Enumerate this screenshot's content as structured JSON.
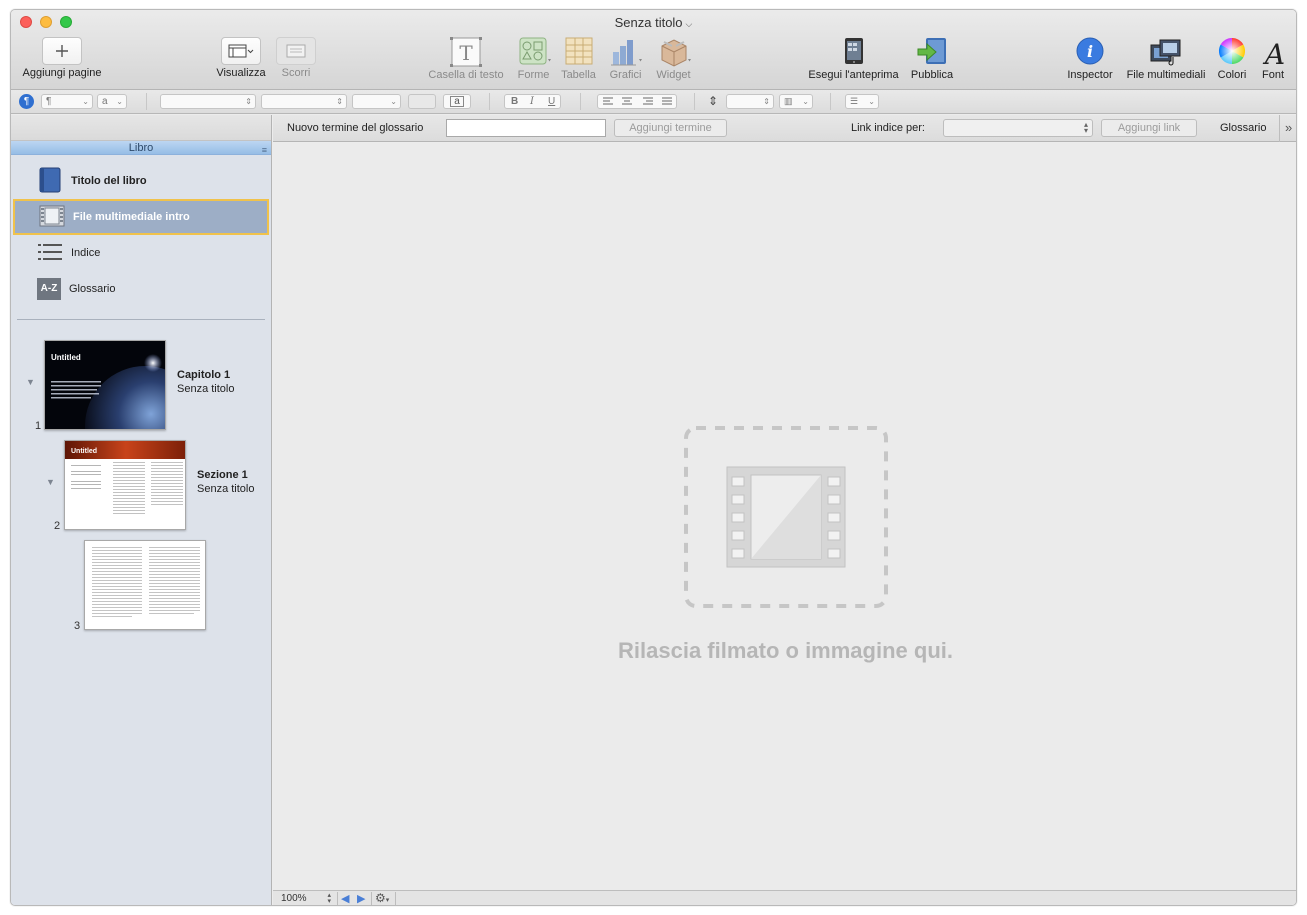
{
  "window": {
    "title": "Senza titolo"
  },
  "toolbar": {
    "add_pages": "Aggiungi pagine",
    "view": "Visualizza",
    "scroll": "Scorri",
    "text_box": "Casella di testo",
    "shapes": "Forme",
    "table": "Tabella",
    "charts": "Grafici",
    "widget": "Widget",
    "preview": "Esegui l'anteprima",
    "publish": "Pubblica",
    "inspector": "Inspector",
    "media": "File multimediali",
    "colors": "Colori",
    "fonts": "Font"
  },
  "formatbar": {
    "paragraph_style": "¶",
    "char_style": "a",
    "colors": {
      "accent": "#2f6fd0"
    }
  },
  "sidebar": {
    "header": "Libro",
    "items": [
      {
        "label": "Titolo del libro",
        "icon": "book-icon"
      },
      {
        "label": "File multimediale intro",
        "icon": "film-icon",
        "selected": true
      },
      {
        "label": "Indice",
        "icon": "list-icon"
      },
      {
        "label": "Glossario",
        "icon": "az-icon",
        "icon_text": "A-Z"
      }
    ],
    "pages": [
      {
        "number": "1",
        "title": "Capitolo 1",
        "subtitle": "Senza titolo",
        "thumb_text": "Untitled"
      },
      {
        "number": "2",
        "title": "Sezione 1",
        "subtitle": "Senza titolo",
        "thumb_text": "Untitled"
      },
      {
        "number": "3"
      }
    ]
  },
  "glossary": {
    "new_term_label": "Nuovo termine del glossario",
    "new_term_value": "",
    "add_term": "Aggiungi termine",
    "index_link_label": "Link indice per:",
    "index_link_value": "",
    "add_link": "Aggiungi link",
    "glossary_label": "Glossario"
  },
  "canvas": {
    "drop_text": "Rilascia filmato o immagine qui."
  },
  "bottombar": {
    "zoom": "100%"
  }
}
